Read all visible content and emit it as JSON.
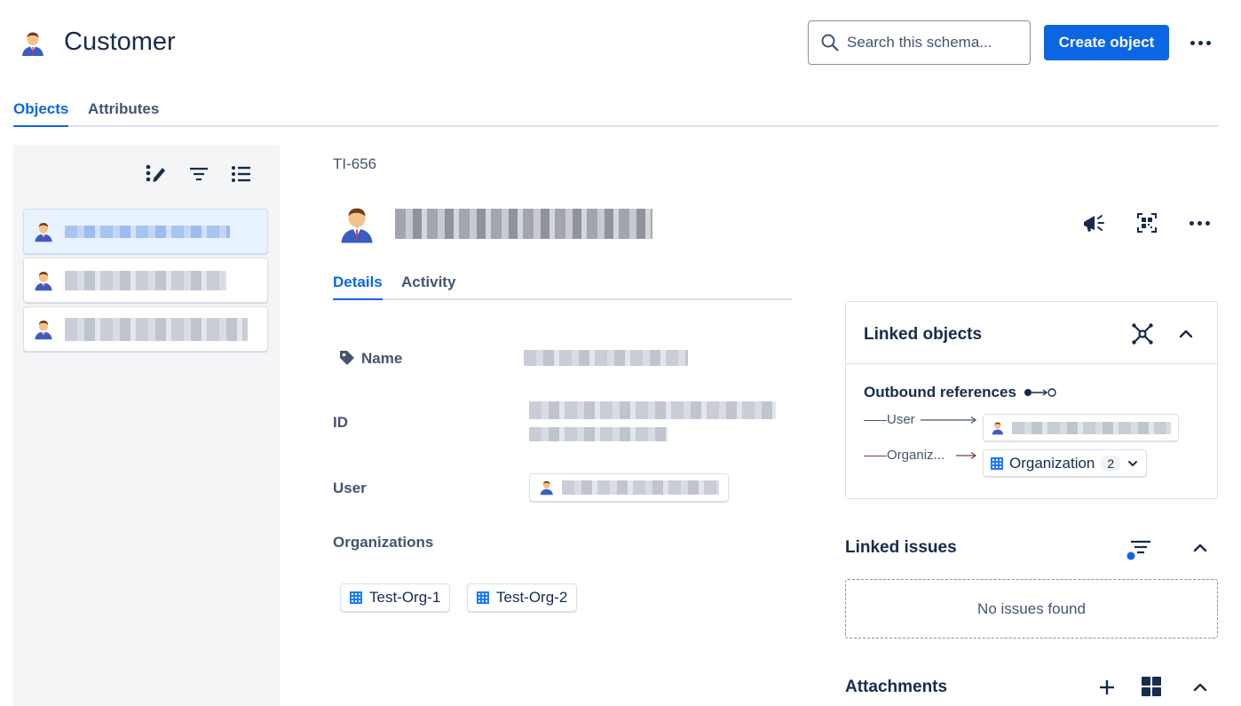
{
  "header": {
    "title": "Customer",
    "title_icon": "person-avatar-icon",
    "search_placeholder": "Search this schema...",
    "create_button_label": "Create object",
    "more_icon": "more-horizontal-icon"
  },
  "top_tabs": [
    {
      "label": "Objects",
      "active": true
    },
    {
      "label": "Attributes",
      "active": false
    }
  ],
  "sidebar": {
    "tools": [
      "bulk-edit-icon",
      "filter-icon",
      "list-view-icon"
    ],
    "items": [
      {
        "selected": true,
        "icon": "person-avatar-icon"
      },
      {
        "selected": false,
        "icon": "person-avatar-icon"
      },
      {
        "selected": false,
        "icon": "person-avatar-icon"
      }
    ]
  },
  "object": {
    "key": "TI-656",
    "avatar": "person-avatar-icon",
    "actions": [
      "megaphone-icon",
      "qr-code-icon",
      "more-horizontal-icon"
    ]
  },
  "detail_tabs": [
    {
      "label": "Details",
      "active": true
    },
    {
      "label": "Activity",
      "active": false
    }
  ],
  "fields": {
    "name_label": "Name",
    "id_label": "ID",
    "user_label": "User",
    "organizations_label": "Organizations",
    "organizations": [
      "Test-Org-1",
      "Test-Org-2"
    ]
  },
  "linked_objects": {
    "title": "Linked objects",
    "outbound_title": "Outbound references",
    "refs": [
      {
        "label": "User",
        "type": "user"
      },
      {
        "label": "Organiz...",
        "target": "Organization",
        "count": "2",
        "type": "organization"
      }
    ]
  },
  "linked_issues": {
    "title": "Linked issues",
    "empty_text": "No issues found"
  },
  "attachments": {
    "title": "Attachments"
  },
  "colors": {
    "accent": "#0c66e4",
    "text": "#172b4d",
    "subtle_text": "#44546f",
    "border": "#dcdfe4",
    "sidebar_bg": "#f4f5f7",
    "selected_bg": "#e9f2ff"
  }
}
